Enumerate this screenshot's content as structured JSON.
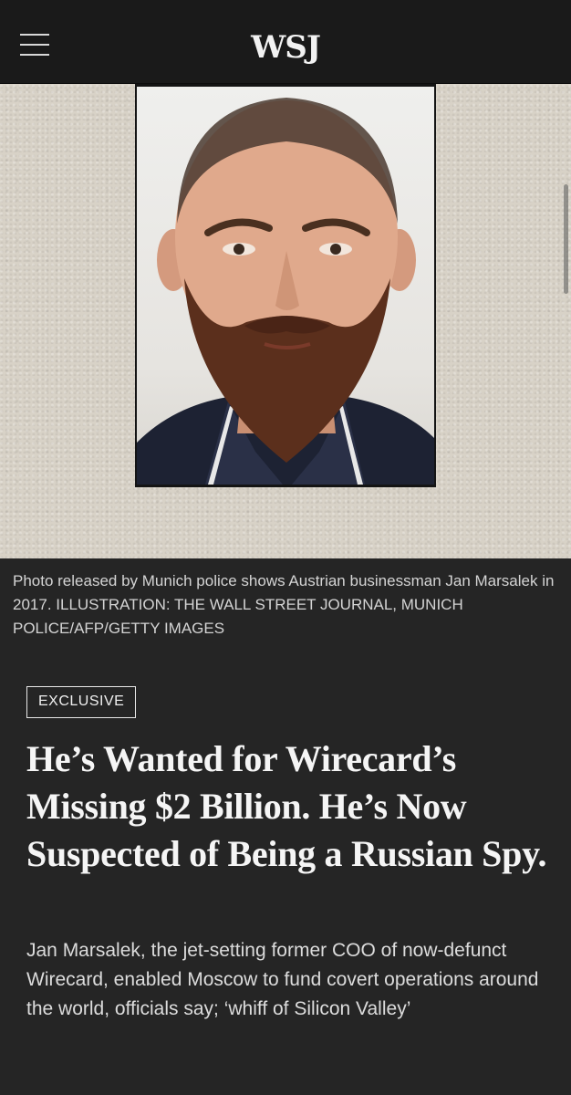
{
  "header": {
    "logo": "WSJ",
    "menu_icon": "hamburger-menu-icon"
  },
  "hero": {
    "image_description": "portrait-photo",
    "background_color": "#d8d2c7"
  },
  "caption": "Photo released by Munich police shows Austrian businessman Jan Marsalek in 2017. ILLUSTRATION: THE WALL STREET JOURNAL, MUNICH POLICE/AFP/GETTY IMAGES",
  "article": {
    "badge": "EXCLUSIVE",
    "headline": "He’s Wanted for Wirecard’s Missing $2 Billion. He’s Now Suspected of Being a Russian Spy.",
    "dek": "Jan Marsalek, the jet-setting former COO of now-defunct Wirecard, enabled Moscow to fund covert operations around the world, officials say; ‘whiff of Silicon Valley’"
  },
  "colors": {
    "page_background": "#252525",
    "header_background": "#1a1a1a",
    "text_primary": "#f5f5f5"
  }
}
